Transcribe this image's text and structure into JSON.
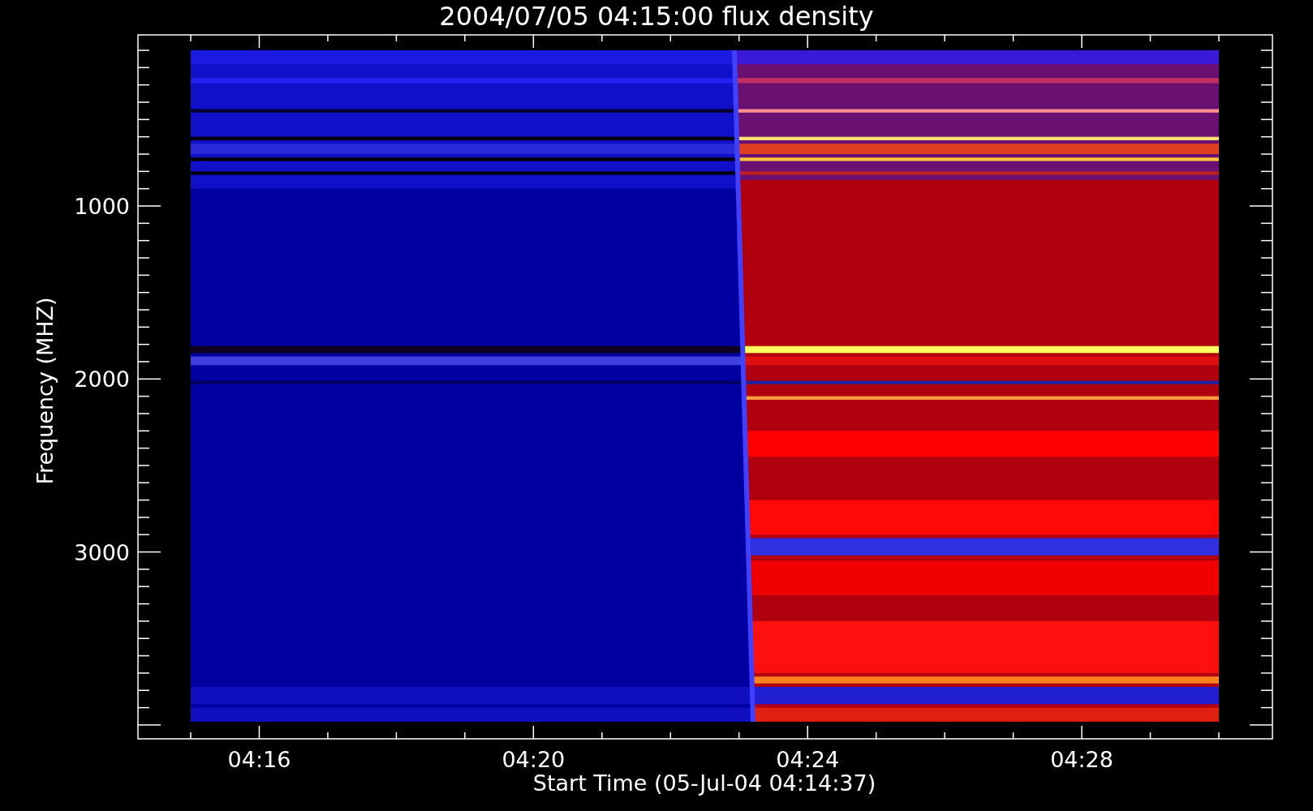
{
  "title": "2004/07/05 04:15:00 flux density",
  "xlabel": "Start Time (05-Jul-04 04:14:37)",
  "ylabel": "Frequency (MHZ)",
  "xticks": [
    {
      "label": "04:16"
    },
    {
      "label": "04:20"
    },
    {
      "label": "04:24"
    },
    {
      "label": "04:28"
    }
  ],
  "yticks": [
    {
      "label": "1000"
    },
    {
      "label": "2000"
    },
    {
      "label": "3000"
    }
  ]
}
